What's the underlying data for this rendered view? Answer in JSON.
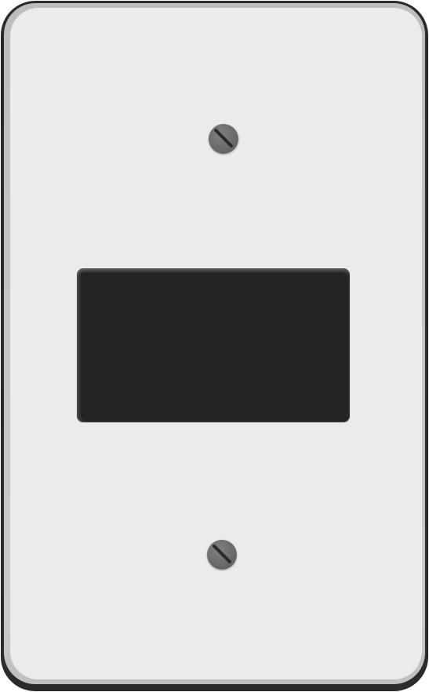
{
  "device": {
    "type": "blank wall plate",
    "components": [
      "screw-top",
      "switch-opening",
      "screw-bottom"
    ]
  },
  "colors": {
    "plate_face": "#ebebeb",
    "plate_rim": "#c4c4c4",
    "plate_border": "#2b2b2b",
    "opening": "#232323",
    "screw": "#6a6a6a",
    "screw_slot": "#2a2a2a"
  }
}
